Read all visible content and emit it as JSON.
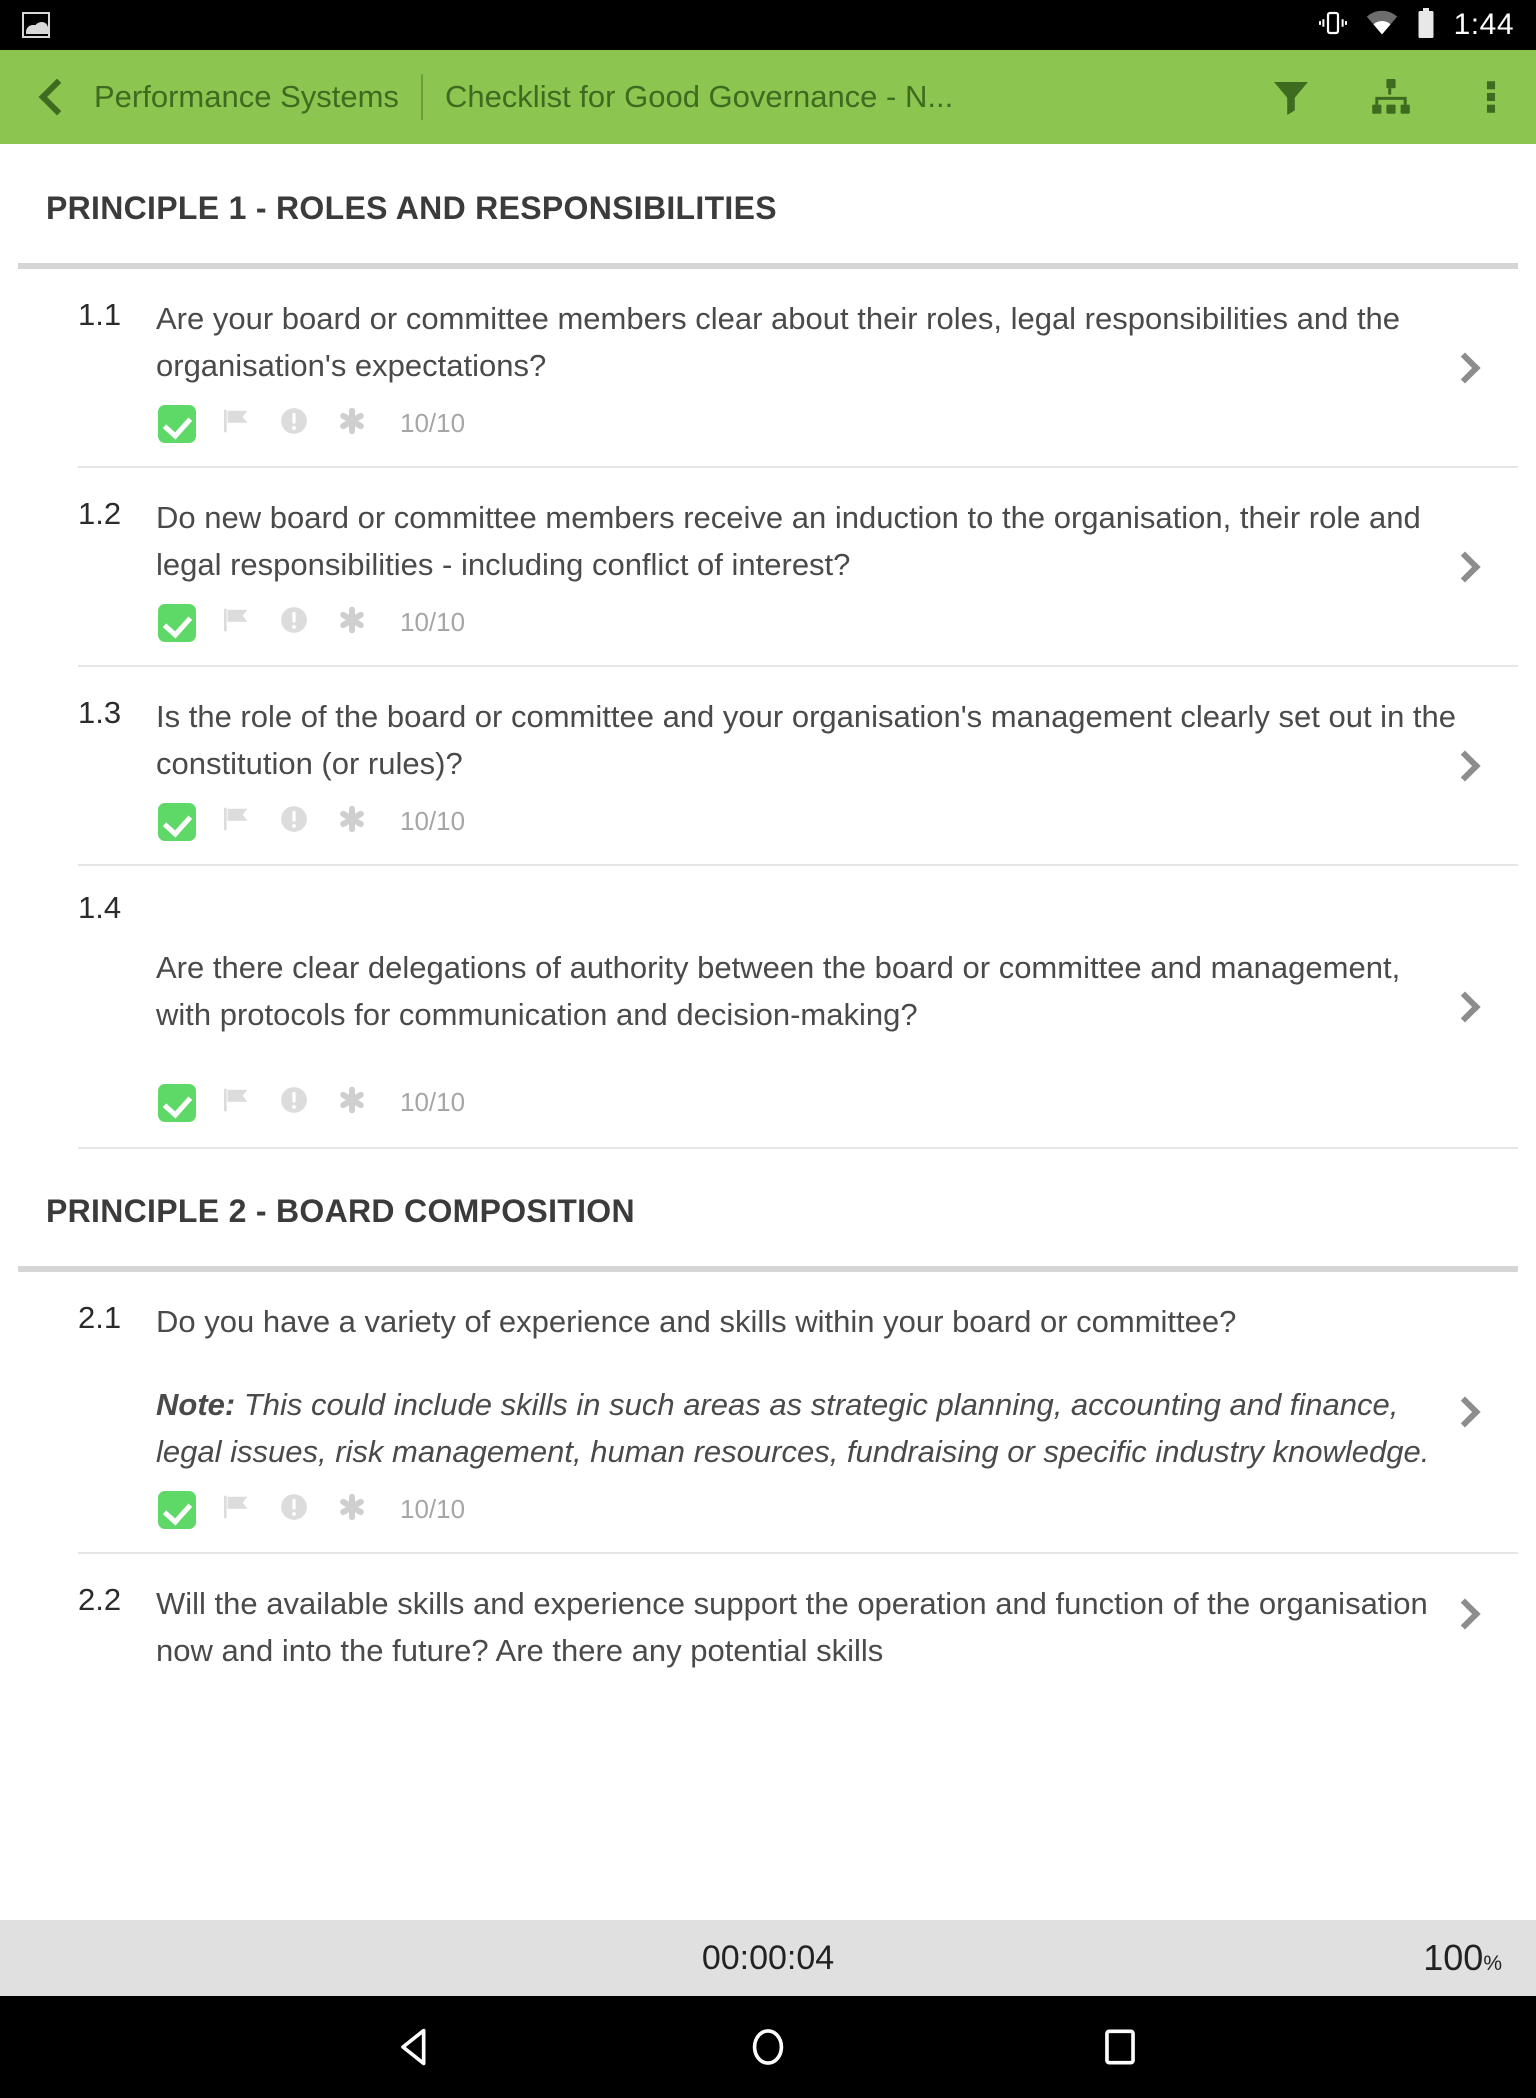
{
  "status_bar": {
    "left_icon": "image-icon",
    "icons": [
      "vibrate-icon",
      "wifi-icon",
      "battery-icon"
    ],
    "clock": "1:44"
  },
  "app_bar": {
    "back_icon": "back-chevron-icon",
    "title": "Performance Systems",
    "subtitle": "Checklist for Good Governance - N...",
    "actions": [
      {
        "name": "filter-icon",
        "label": "Filter"
      },
      {
        "name": "hierarchy-icon",
        "label": "Hierarchy"
      },
      {
        "name": "overflow-menu-icon",
        "label": "More options"
      }
    ]
  },
  "sections": [
    {
      "heading": "PRINCIPLE 1 - ROLES AND RESPONSIBILITIES",
      "questions": [
        {
          "number": "1.1",
          "text": "Are your board or committee members clear about their roles, legal responsibilities and the organisation's expectations?",
          "note": "",
          "score": "10/10",
          "checked": true
        },
        {
          "number": "1.2",
          "text": "Do new board or committee members receive an induction to the organisation, their role and legal responsibilities - including conflict of interest?",
          "note": "",
          "score": "10/10",
          "checked": true
        },
        {
          "number": "1.3",
          "text": "Is the role of the board or committee and your organisation's management clearly set out in the constitution (or rules)?",
          "note": "",
          "score": "10/10",
          "checked": true
        },
        {
          "number": "1.4",
          "text": "Are there clear delegations of authority between the board or committee and management, with protocols for communication and decision-making?",
          "note": "",
          "score": "10/10",
          "checked": true
        }
      ]
    },
    {
      "heading": "PRINCIPLE 2 - BOARD COMPOSITION",
      "questions": [
        {
          "number": "2.1",
          "text": "Do you have a variety of experience and skills within your board or committee?",
          "note_label": "Note:",
          "note": " This could include skills in such areas as strategic planning, accounting and finance, legal issues, risk management, human resources, fundraising or specific industry knowledge.",
          "score": "10/10",
          "checked": true
        },
        {
          "number": "2.2",
          "text": "Will the available skills and experience support the operation and function of the organisation now and into the future? Are there any potential skills",
          "note": "",
          "score": "",
          "checked": false
        }
      ]
    }
  ],
  "meta_icons": {
    "checkbox": "checkbox-checked-icon",
    "flag": "flag-icon",
    "info": "exclamation-circle-icon",
    "asterisk": "asterisk-icon",
    "chevron": "chevron-right-icon"
  },
  "footer": {
    "timer": "00:00:04",
    "percent": "100",
    "percent_symbol": "%"
  },
  "nav_bar": {
    "back": "nav-back-icon",
    "home": "nav-home-icon",
    "recents": "nav-recents-icon"
  },
  "colors": {
    "app_bar_green": "#8cc550",
    "app_bar_text": "#3f6b20",
    "check_green": "#5ed866",
    "footer_bg": "#e0e0e0"
  }
}
